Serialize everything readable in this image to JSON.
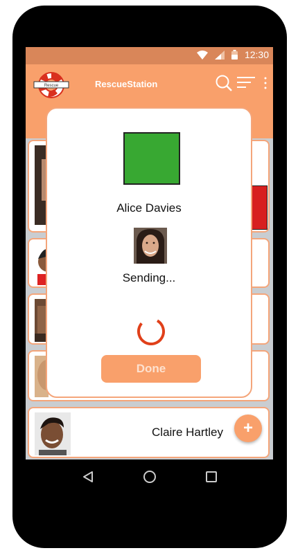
{
  "status_bar": {
    "time": "12:30"
  },
  "app": {
    "title": "RescueStation",
    "logo_text": "Rescue"
  },
  "contacts": [
    {
      "name": ""
    },
    {
      "name": ""
    },
    {
      "name": ""
    },
    {
      "name": ""
    },
    {
      "name": "Claire Hartley"
    }
  ],
  "fab": {
    "label": "+"
  },
  "dialog": {
    "recipient": "Alice Davies",
    "status": "Sending...",
    "done_label": "Done",
    "swatch_color": "#38a832"
  },
  "colors": {
    "accent": "#f9a06b",
    "status_bar": "#d98659",
    "spinner": "#e0401a",
    "red_block": "#d71f1f"
  },
  "icons": [
    "wifi-icon",
    "signal-icon",
    "battery-icon",
    "search-icon",
    "sort-icon",
    "overflow-menu-icon",
    "back-icon",
    "home-icon",
    "recents-icon"
  ]
}
